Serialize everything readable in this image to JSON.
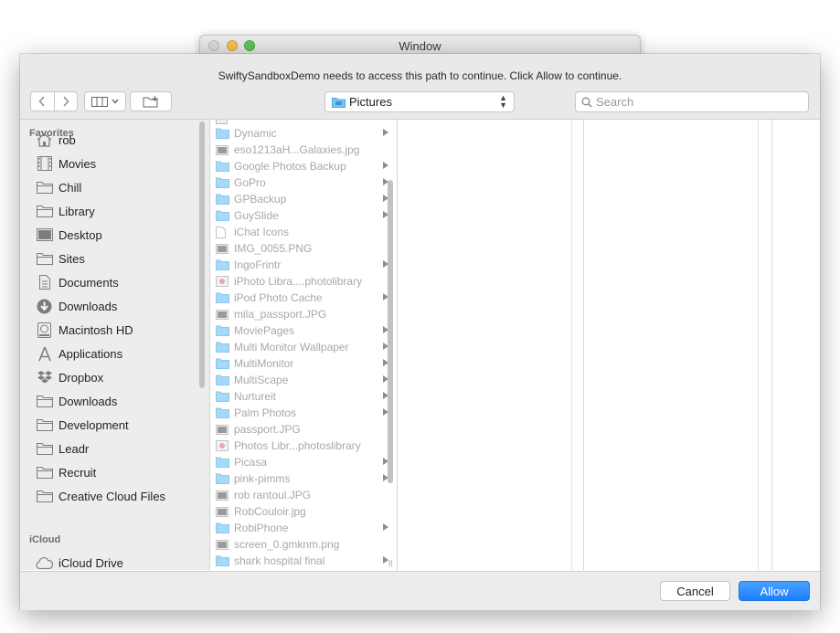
{
  "background_window": {
    "title": "Window"
  },
  "message": "SwiftySandboxDemo needs to access this path to continue. Click Allow to continue.",
  "toolbar": {
    "back_icon": "chevron-left-icon",
    "forward_icon": "chevron-right-icon",
    "view_icon": "column-view-icon",
    "new_folder_icon": "new-folder-icon",
    "location": "Pictures",
    "search_placeholder": "Search"
  },
  "sidebar": {
    "favorites_header": "Favorites",
    "favorites": [
      {
        "label": "rob",
        "icon": "home-icon"
      },
      {
        "label": "Movies",
        "icon": "film-icon"
      },
      {
        "label": "Chill",
        "icon": "folder-icon"
      },
      {
        "label": "Library",
        "icon": "folder-icon"
      },
      {
        "label": "Desktop",
        "icon": "desktop-icon"
      },
      {
        "label": "Sites",
        "icon": "folder-icon"
      },
      {
        "label": "Documents",
        "icon": "document-icon"
      },
      {
        "label": "Downloads",
        "icon": "download-icon"
      },
      {
        "label": "Macintosh HD",
        "icon": "hard-drive-icon"
      },
      {
        "label": "Applications",
        "icon": "applications-icon"
      },
      {
        "label": "Dropbox",
        "icon": "dropbox-icon"
      },
      {
        "label": "Downloads",
        "icon": "folder-icon"
      },
      {
        "label": "Development",
        "icon": "folder-icon"
      },
      {
        "label": "Leadr",
        "icon": "folder-icon"
      },
      {
        "label": "Recruit",
        "icon": "folder-icon"
      },
      {
        "label": "Creative Cloud Files",
        "icon": "folder-icon"
      }
    ],
    "icloud_header": "iCloud",
    "icloud": [
      {
        "label": "iCloud Drive",
        "icon": "cloud-icon"
      }
    ]
  },
  "files": [
    {
      "name": "Dynamic",
      "type": "folder",
      "has_children": true
    },
    {
      "name": "eso1213aH...Galaxies.jpg",
      "type": "image",
      "has_children": false
    },
    {
      "name": "Google Photos Backup",
      "type": "folder",
      "has_children": true
    },
    {
      "name": "GoPro",
      "type": "folder",
      "has_children": true
    },
    {
      "name": "GPBackup",
      "type": "folder",
      "has_children": true
    },
    {
      "name": "GuySlide",
      "type": "folder",
      "has_children": true
    },
    {
      "name": "iChat Icons",
      "type": "document",
      "has_children": false
    },
    {
      "name": "IMG_0055.PNG",
      "type": "image",
      "has_children": false
    },
    {
      "name": "IngoFrintr",
      "type": "folder",
      "has_children": true
    },
    {
      "name": "iPhoto Libra....photolibrary",
      "type": "library",
      "has_children": false
    },
    {
      "name": "iPod Photo Cache",
      "type": "folder",
      "has_children": true
    },
    {
      "name": "mila_passport.JPG",
      "type": "image",
      "has_children": false
    },
    {
      "name": "MoviePages",
      "type": "folder",
      "has_children": true
    },
    {
      "name": "Multi Monitor Wallpaper",
      "type": "folder",
      "has_children": true
    },
    {
      "name": "MultiMonitor",
      "type": "folder",
      "has_children": true
    },
    {
      "name": "MultiScape",
      "type": "folder",
      "has_children": true
    },
    {
      "name": "Nurtureit",
      "type": "folder",
      "has_children": true
    },
    {
      "name": "Palm Photos",
      "type": "folder",
      "has_children": true
    },
    {
      "name": "passport.JPG",
      "type": "image",
      "has_children": false
    },
    {
      "name": "Photos Libr...photoslibrary",
      "type": "library",
      "has_children": false
    },
    {
      "name": "Picasa",
      "type": "folder",
      "has_children": true
    },
    {
      "name": "pink-pimms",
      "type": "folder",
      "has_children": true
    },
    {
      "name": "rob rantoul.JPG",
      "type": "image",
      "has_children": false
    },
    {
      "name": "RobCouloir.jpg",
      "type": "image",
      "has_children": false
    },
    {
      "name": "RobiPhone",
      "type": "folder",
      "has_children": true
    },
    {
      "name": "screen_0.gmknm.png",
      "type": "image",
      "has_children": false
    },
    {
      "name": "shark hospital final",
      "type": "folder",
      "has_children": true
    }
  ],
  "buttons": {
    "cancel": "Cancel",
    "allow": "Allow"
  },
  "colors": {
    "accent": "#1c7fff",
    "folder": "#8fcdf5",
    "sidebar_bg": "#ededed"
  }
}
